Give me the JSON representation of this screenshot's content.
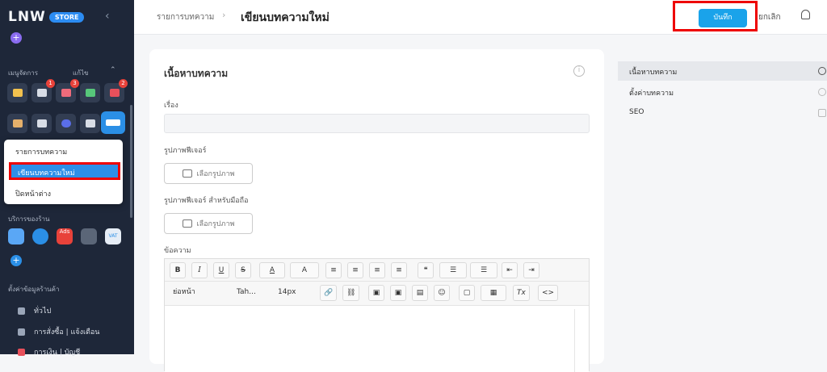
{
  "sidebar": {
    "logo_text": "LNW",
    "store_badge": "STORE",
    "collapse_icon": "chevron-left-icon",
    "section_manage": "เมนูจัดการ",
    "section_edit": "แก้ไข",
    "tile_badges": {
      "order": "1",
      "piggy": "3",
      "card": "2"
    },
    "popup": {
      "items": [
        "รายการบทความ",
        "เขียนบทความใหม่",
        "ปิดหน้าต่าง"
      ]
    },
    "section_services": "บริการของร้าน",
    "ads_label": "Ads",
    "vat_label": "VAT",
    "section_settings": "ตั้งค่าข้อมูลร้านค้า",
    "nav": [
      "ทั่วไป",
      "การสั่งซื้อ | แจ้งเตือน",
      "การเงิน | บัญชี"
    ]
  },
  "header": {
    "breadcrumb_parent": "รายการบทความ",
    "breadcrumb_current": "เขียนบทความใหม่",
    "save_label": "บันทึก",
    "cancel_label": "ยกเลิก"
  },
  "card": {
    "title": "เนื้อหาบทความ",
    "subject_label": "เรื่อง",
    "subject_value": "",
    "feature_image_label": "รูปภาพฟีเจอร์",
    "feature_image_mobile_label": "รูปภาพฟีเจอร์ สำหรับมือถือ",
    "choose_image_label": "เลือกรูปภาพ",
    "message_label": "ข้อความ"
  },
  "toolbar": {
    "bold": "B",
    "italic": "I",
    "underline": "U",
    "strike": "S",
    "font_color": "A",
    "bg_color": "A",
    "quote": "❝",
    "paragraph": "ย่อหน้า",
    "font": "Tah...",
    "size": "14px",
    "clear": "Tx",
    "code": "<>"
  },
  "right_nav": {
    "items": [
      "เนื้อหาบทความ",
      "ตั้งค่าบทความ",
      "SEO"
    ]
  },
  "colors": {
    "sidebar_bg": "#1e2739",
    "primary": "#1aa3ea",
    "highlight_border": "#ee0000"
  }
}
